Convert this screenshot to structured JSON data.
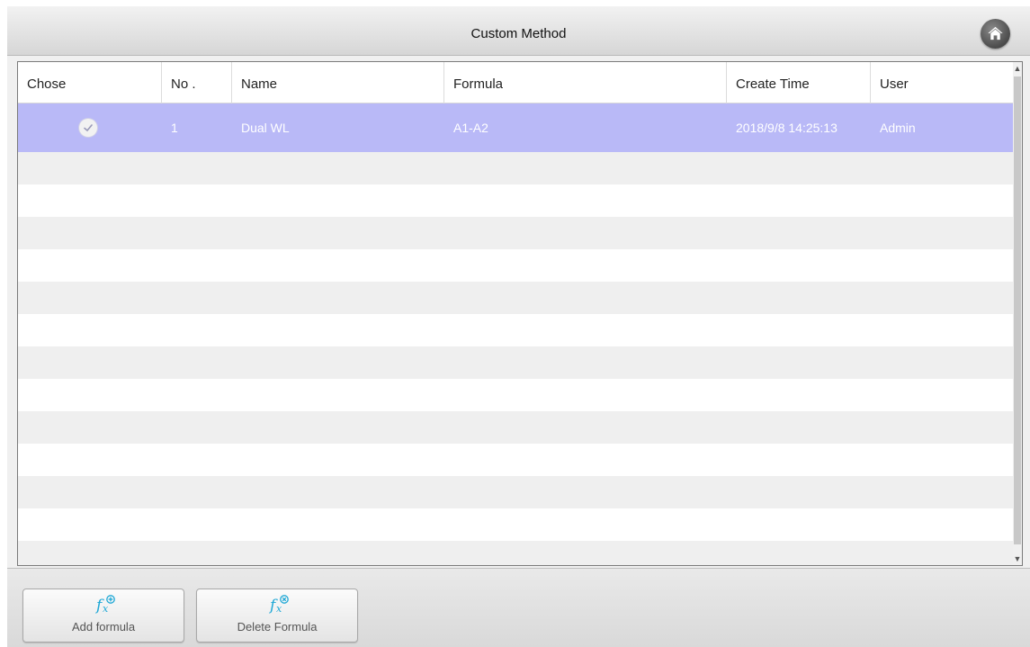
{
  "window": {
    "title": "Custom Method"
  },
  "table": {
    "columns": [
      "Chose",
      "No .",
      "Name",
      "Formula",
      "Create Time",
      "User"
    ],
    "rows": [
      {
        "chosen": true,
        "no": "1",
        "name": "Dual WL",
        "formula": "A1-A2",
        "create_time": "2018/9/8 14:25:13",
        "user": "Admin"
      }
    ]
  },
  "toolbar": {
    "add_label": "Add formula",
    "delete_label": "Delete Formula"
  },
  "icons": {
    "home": "home-icon",
    "check": "check-icon",
    "add_formula": "fx-add-icon",
    "delete_formula": "fx-delete-icon"
  },
  "colors": {
    "selected_row": "#b9b9f7",
    "stripe_row": "#efefef",
    "accent": "#1fa8d6"
  }
}
